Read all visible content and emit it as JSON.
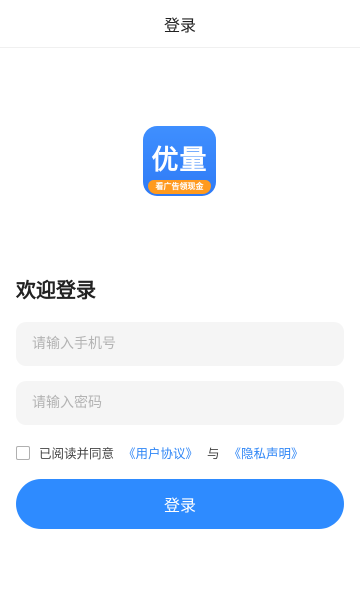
{
  "header": {
    "title": "登录"
  },
  "logo": {
    "text": "优量",
    "ribbon": "看广告领现金"
  },
  "welcome": "欢迎登录",
  "phone_input": {
    "placeholder": "请输入手机号",
    "value": ""
  },
  "password_input": {
    "placeholder": "请输入密码",
    "value": ""
  },
  "agreement": {
    "checked": false,
    "prefix": "已阅读并同意",
    "user_agreement": "《用户协议》",
    "conjunction": "与",
    "privacy_policy": "《隐私声明》"
  },
  "login_button": {
    "label": "登录"
  },
  "colors": {
    "primary": "#2e8bff",
    "link": "#2f86f6",
    "ribbon": "#ff9a1f"
  }
}
